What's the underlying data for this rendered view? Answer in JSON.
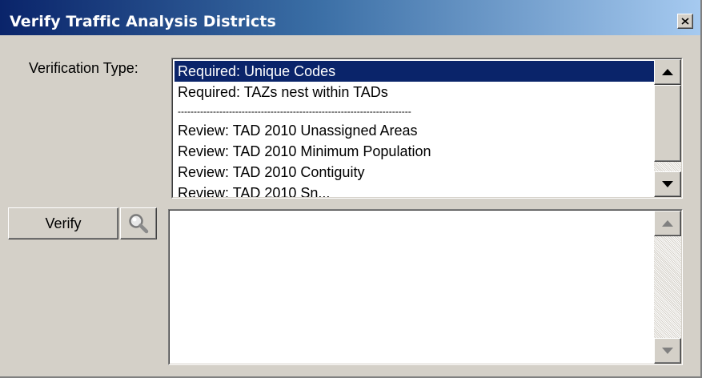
{
  "window": {
    "title": "Verify Traffic Analysis Districts",
    "close_glyph": "✕"
  },
  "verification": {
    "label": "Verification Type:",
    "items": [
      "Required: Unique Codes",
      "Required: TAZs nest within TADs",
      "-------------------------------------------------------------------------",
      "Review: TAD 2010 Unassigned Areas",
      "Review: TAD 2010 Minimum Population",
      "Review: TAD 2010 Contiguity",
      "Review: TAD 2010 Sn..."
    ],
    "selected_index": 0
  },
  "actions": {
    "verify_label": "Verify",
    "zoom_icon": "magnifier-icon"
  },
  "output": {
    "text": ""
  },
  "colors": {
    "face": "#d4d0c8",
    "title_start": "#0a246a",
    "title_end": "#a6caf0",
    "selection": "#0a246a"
  }
}
